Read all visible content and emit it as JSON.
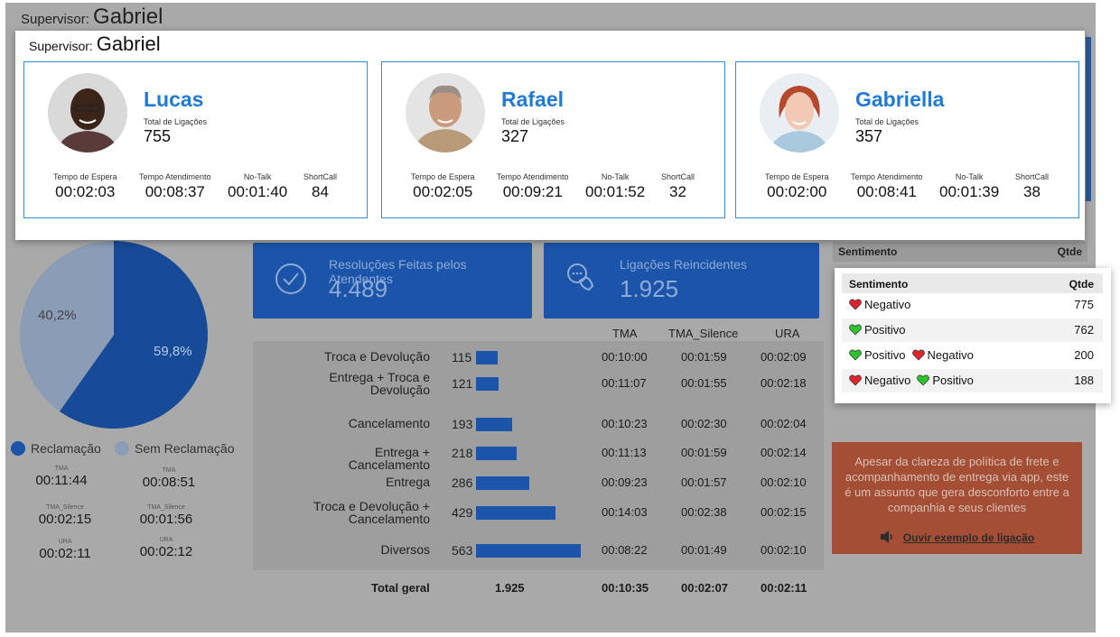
{
  "supervisor": {
    "label": "Supervisor:",
    "name": "Gabriel"
  },
  "agents": [
    {
      "name": "Lucas",
      "total_label": "Total de Ligações",
      "total": "755",
      "metrics": [
        {
          "label": "Tempo de Espera",
          "value": "00:02:03"
        },
        {
          "label": "Tempo Atendimento",
          "value": "00:08:37"
        },
        {
          "label": "No-Talk",
          "value": "00:01:40"
        },
        {
          "label": "ShortCall",
          "value": "84"
        }
      ]
    },
    {
      "name": "Rafael",
      "total_label": "Total de Ligações",
      "total": "327",
      "metrics": [
        {
          "label": "Tempo de Espera",
          "value": "00:02:05"
        },
        {
          "label": "Tempo Atendimento",
          "value": "00:09:21"
        },
        {
          "label": "No-Talk",
          "value": "00:01:52"
        },
        {
          "label": "ShortCall",
          "value": "32"
        }
      ]
    },
    {
      "name": "Gabriella",
      "total_label": "Total de Ligações",
      "total": "357",
      "metrics": [
        {
          "label": "Tempo de Espera",
          "value": "00:02:00"
        },
        {
          "label": "Tempo Atendimento",
          "value": "00:08:41"
        },
        {
          "label": "No-Talk",
          "value": "00:01:39"
        },
        {
          "label": "ShortCall",
          "value": "38"
        }
      ]
    }
  ],
  "pie": {
    "slices": [
      {
        "name": "Reclamação",
        "value": 59.8,
        "label": "59,8%",
        "color": "#1b54a8"
      },
      {
        "name": "Sem Reclamação",
        "value": 40.2,
        "label": "40,2%",
        "color": "#8a9cb6"
      }
    ],
    "stats": [
      {
        "label": "TMA",
        "left": "00:11:44",
        "right": "00:08:51"
      },
      {
        "label": "TMA_Silence",
        "left": "00:02:15",
        "right": "00:01:56"
      },
      {
        "label": "URA",
        "left": "00:02:11",
        "right": "00:02:12"
      }
    ]
  },
  "tiles": [
    {
      "title": "Resoluções Feitas pelos Atendentes",
      "value": "4.489",
      "icon": "check-circle-icon"
    },
    {
      "title": "Ligações Reincidentes",
      "value": "1.925",
      "icon": "phone-chat-icon"
    }
  ],
  "table": {
    "headers": [
      "TMA",
      "TMA_Silence",
      "URA"
    ],
    "rows": [
      {
        "label": "Troca e Devolução",
        "count": 115,
        "tma": "00:10:00",
        "silence": "00:01:59",
        "ura": "00:02:09"
      },
      {
        "label": "Entrega + Troca e Devolução",
        "count": 121,
        "tma": "00:11:07",
        "silence": "00:01:55",
        "ura": "00:02:18"
      },
      {
        "label": "Cancelamento",
        "count": 193,
        "tma": "00:10:23",
        "silence": "00:02:30",
        "ura": "00:02:04"
      },
      {
        "label": "Entrega + Cancelamento",
        "count": 218,
        "tma": "00:11:13",
        "silence": "00:01:59",
        "ura": "00:02:14"
      },
      {
        "label": "Entrega",
        "count": 286,
        "tma": "00:09:23",
        "silence": "00:01:57",
        "ura": "00:02:10"
      },
      {
        "label": "Troca e Devolução + Cancelamento",
        "count": 429,
        "tma": "00:14:03",
        "silence": "00:02:38",
        "ura": "00:02:15"
      },
      {
        "label": "Diversos",
        "count": 563,
        "tma": "00:08:22",
        "silence": "00:01:49",
        "ura": "00:02:10"
      }
    ],
    "total": {
      "label": "Total geral",
      "count": "1.925",
      "tma": "00:10:35",
      "silence": "00:02:07",
      "ura": "00:02:11"
    }
  },
  "sentiment": {
    "header_label": "Sentimento",
    "header_qty": "Qtde",
    "rows": [
      {
        "parts": [
          {
            "heart": "red",
            "text": "Negativo"
          }
        ],
        "qty": "775"
      },
      {
        "parts": [
          {
            "heart": "green",
            "text": "Positivo"
          }
        ],
        "qty": "762"
      },
      {
        "parts": [
          {
            "heart": "green",
            "text": "Positivo"
          },
          {
            "heart": "red",
            "text": "Negativo"
          }
        ],
        "qty": "200"
      },
      {
        "parts": [
          {
            "heart": "red",
            "text": "Negativo"
          },
          {
            "heart": "green",
            "text": "Positivo"
          }
        ],
        "qty": "188"
      }
    ]
  },
  "note": {
    "text": "Apesar da clareza de política de frete e acompanhamento de entrega via app, este é um assunto que gera desconforto entre a companhia e seus clientes",
    "link": "Ouvir exemplo de ligação"
  },
  "colors": {
    "accent": "#1f7ad8",
    "blue_tile": "#1b54a8",
    "heart_red": "#e0242b",
    "heart_green": "#2fc42f"
  }
}
